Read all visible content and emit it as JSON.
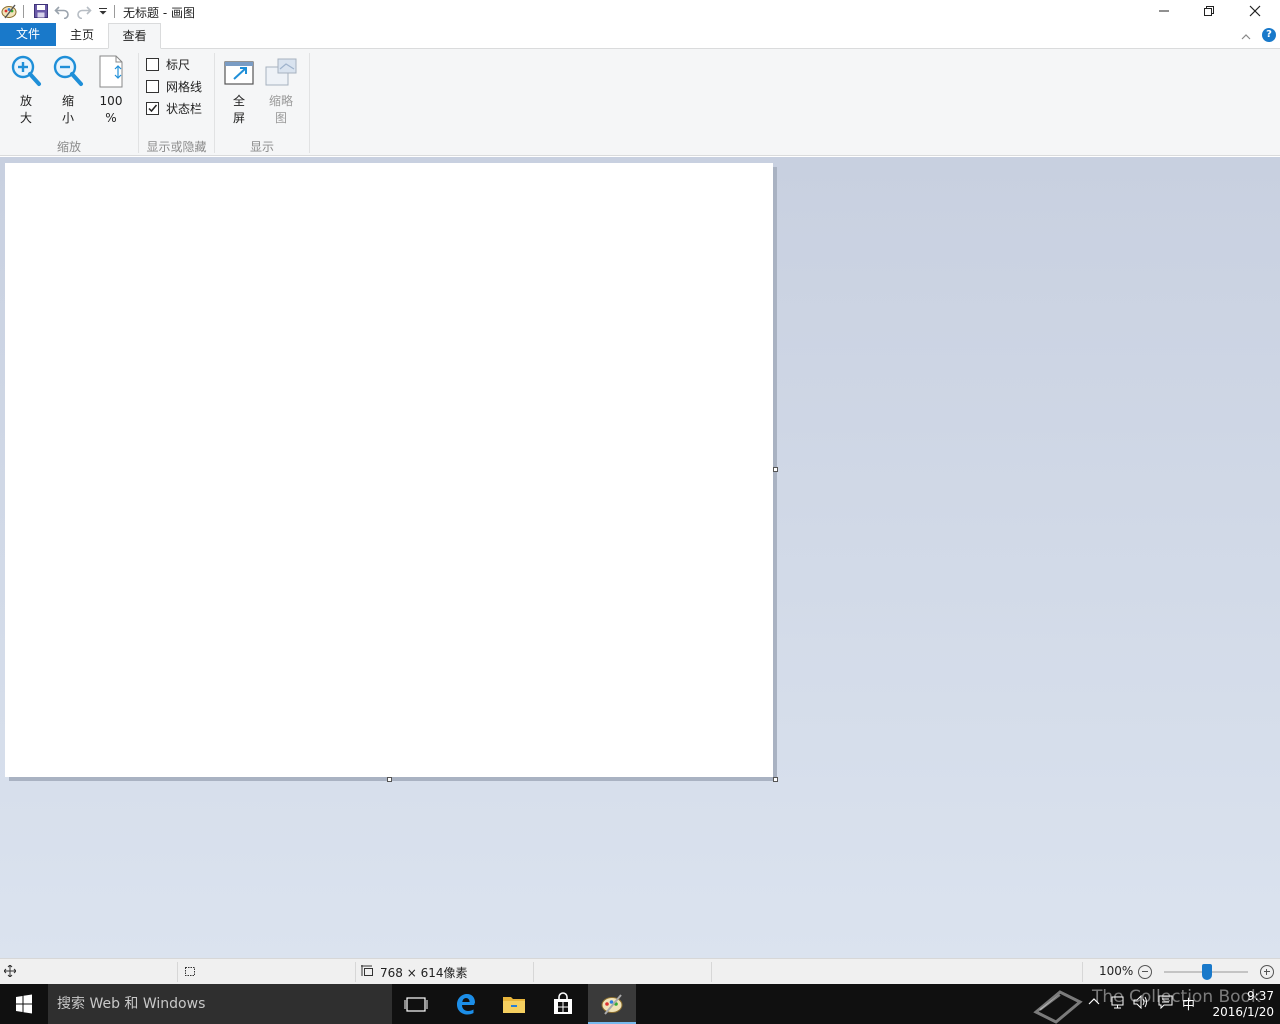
{
  "titlebar": {
    "title": "无标题 - 画图",
    "icons": [
      "paint-app-icon",
      "save-icon",
      "undo-icon",
      "redo-icon",
      "customize-quick-access-icon"
    ],
    "controls": [
      "minimize-icon",
      "restore-icon",
      "close-icon"
    ]
  },
  "tabs": {
    "file": "文件",
    "home": "主页",
    "view": "查看",
    "active": "查看"
  },
  "ribbon": {
    "zoom_group": {
      "label": "缩放",
      "zoom_in": [
        "放",
        "大"
      ],
      "zoom_out": [
        "缩",
        "小"
      ],
      "hundred": [
        "100",
        "%"
      ]
    },
    "show_hide_group": {
      "label": "显示或隐藏",
      "items": [
        {
          "label": "标尺",
          "checked": false
        },
        {
          "label": "网格线",
          "checked": false
        },
        {
          "label": "状态栏",
          "checked": true
        }
      ]
    },
    "display_group": {
      "label": "显示",
      "fullscreen": [
        "全",
        "屏"
      ],
      "thumbnail": [
        "缩略",
        "图"
      ]
    }
  },
  "statusbar": {
    "dimensions": "768 × 614像素",
    "zoom_level": "100%"
  },
  "taskbar": {
    "search_placeholder": "搜索 Web 和 Windows",
    "ime": "中",
    "time": "9:37",
    "date": "2016/1/20",
    "watermark": "The Collection Book"
  },
  "colors": {
    "accent": "#1979ca",
    "ribbon_bg": "#f5f6f7",
    "workspace_top": "#c8d0e0",
    "workspace_bottom": "#dbe3ef",
    "taskbar": "#101010"
  }
}
